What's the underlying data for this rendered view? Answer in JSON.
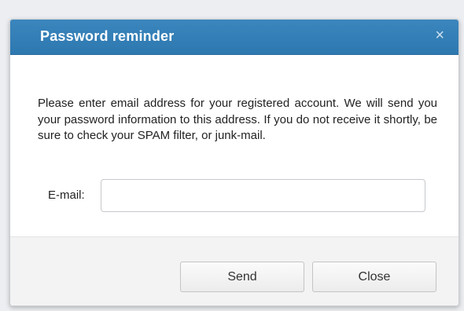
{
  "dialog": {
    "title": "Password reminder",
    "close_icon": "close-icon",
    "close_glyph": "×",
    "message": "Please enter email address for your registered account. We will send you your password information to this address. If you do not receive it shortly, be sure to check your SPAM filter, or junk-mail.",
    "email": {
      "label": "E-mail:",
      "value": "",
      "placeholder": ""
    },
    "buttons": {
      "send_label": "Send",
      "close_label": "Close"
    }
  },
  "colors": {
    "titlebar": "#2e78b0",
    "title_text": "#ffffff",
    "footer": "#f3f3f3"
  }
}
